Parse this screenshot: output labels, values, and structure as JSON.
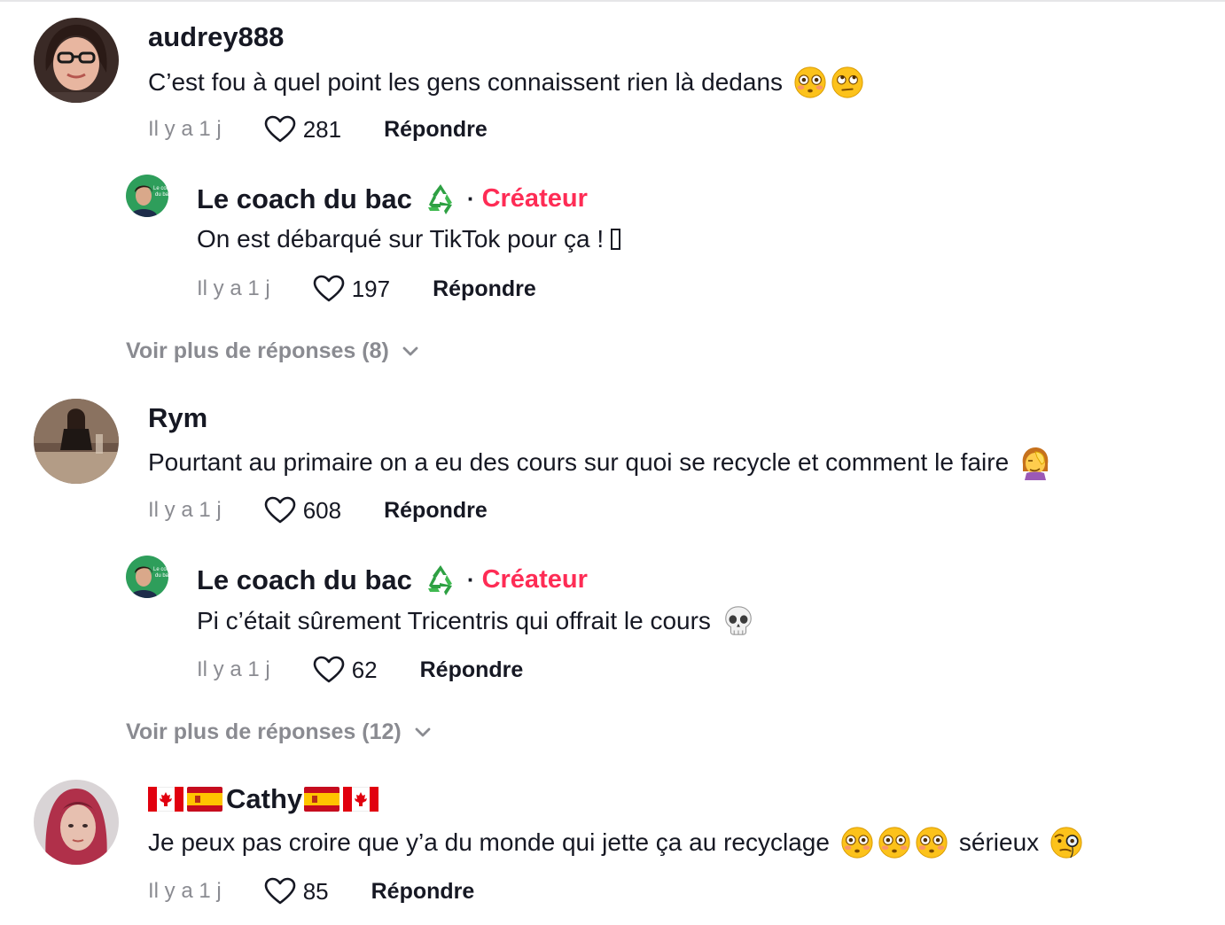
{
  "comments": [
    {
      "username": "audrey888",
      "text": "C’est fou à quel point les gens connaissent rien là dedans",
      "emojis": [
        "flushed-face",
        "rolling-eyes-face"
      ],
      "time": "Il y a 1 j",
      "likes": "281",
      "reply_label": "Répondre",
      "replies": [
        {
          "username": "Le coach du bac",
          "username_emoji": "recycle-symbol",
          "creator_label": "Créateur",
          "text": "On est débarqué sur TikTok pour ça !",
          "time": "Il y a 1 j",
          "likes": "197",
          "reply_label": "Répondre"
        }
      ],
      "more_replies": "Voir plus de réponses (8)"
    },
    {
      "username": "Rym",
      "text": "Pourtant au primaire on a eu des cours sur quoi se recycle et comment le faire",
      "emojis": [
        "face-palm-woman"
      ],
      "time": "Il y a 1 j",
      "likes": "608",
      "reply_label": "Répondre",
      "replies": [
        {
          "username": "Le coach du bac",
          "username_emoji": "recycle-symbol",
          "creator_label": "Créateur",
          "text": "Pi c’était sûrement Tricentris qui offrait le cours",
          "time": "Il y a 1 j",
          "likes": "62",
          "reply_label": "Répondre"
        }
      ],
      "more_replies": "Voir plus de réponses (12)"
    },
    {
      "username": "Cathy",
      "username_flags": [
        "canada-flag",
        "spain-flag",
        "spain-flag",
        "canada-flag"
      ],
      "text": "Je peux pas croire que y’a du monde qui jette ça au recyclage",
      "text_suffix": "sérieux",
      "emojis": [
        "flushed-face",
        "flushed-face",
        "flushed-face",
        "monocle-face"
      ],
      "time": "Il y a 1 j",
      "likes": "85",
      "reply_label": "Répondre"
    }
  ],
  "colors": {
    "creator": "#fe2c55",
    "muted": "#8a8b91",
    "text": "#161823"
  }
}
